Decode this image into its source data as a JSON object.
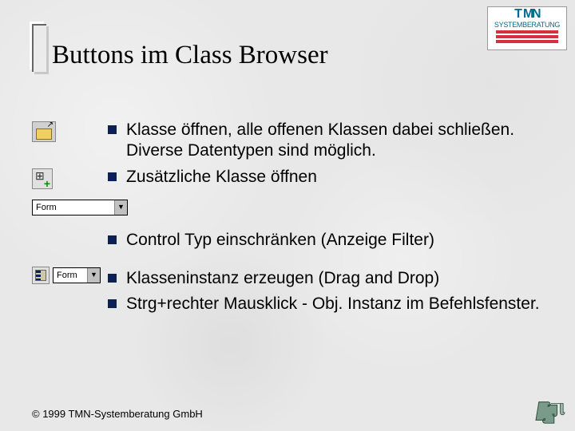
{
  "header": {
    "title": "Buttons im Class Browser",
    "logo": {
      "text": "TMN",
      "subtitle": "SYSTEMBERATUNG"
    }
  },
  "bullets": [
    {
      "text": "Klasse öffnen, alle offenen Klassen dabei schließen. Diverse Datentypen sind möglich."
    },
    {
      "text": "Zusätzliche Klasse öffnen"
    },
    {
      "text": "Control Typ einschränken (Anzeige Filter)"
    },
    {
      "text": "Klasseninstanz erzeugen (Drag and Drop)"
    },
    {
      "text": "Strg+rechter Mausklick - Obj. Instanz im Befehlsfenster."
    }
  ],
  "dropdowns": {
    "filter": {
      "value": "Form"
    },
    "instance": {
      "value": "Form"
    }
  },
  "footer": {
    "copyright": "© 1999 TMN-Systemberatung GmbH"
  },
  "colors": {
    "bullet": "#0B1F5B",
    "logoText": "#006B8F",
    "logoBars": "#d63040"
  }
}
